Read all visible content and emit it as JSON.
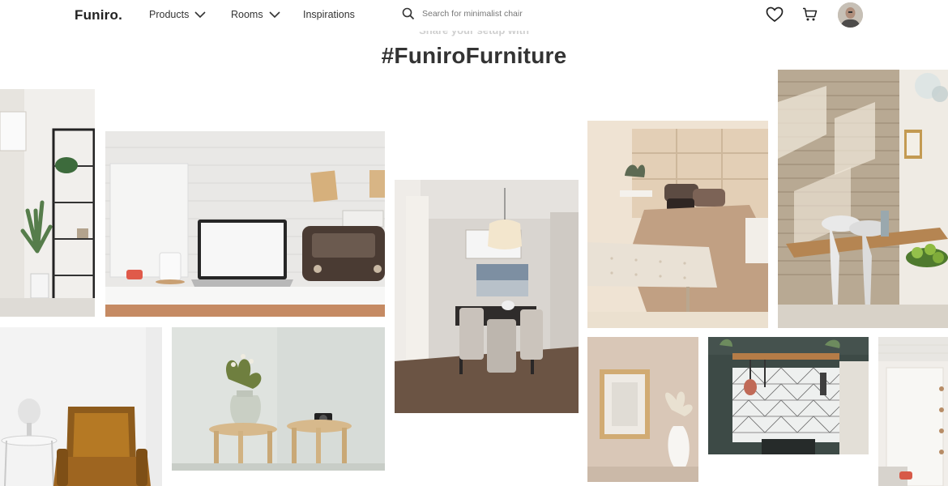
{
  "header": {
    "logo": "Funiro.",
    "nav": [
      {
        "label": "Products"
      },
      {
        "label": "Rooms"
      },
      {
        "label": "Inspirations"
      }
    ],
    "search_placeholder": "Search for minimalist chair"
  },
  "section": {
    "subtitle": "Share your setup with",
    "title": "#FuniroFurniture"
  },
  "icons": {
    "search": "search-icon",
    "wishlist": "heart-icon",
    "cart": "cart-icon",
    "chevron": "chevron-down-icon"
  },
  "colors": {
    "text": "#333333",
    "subtitle": "#cfcfcf",
    "background": "#ffffff"
  }
}
